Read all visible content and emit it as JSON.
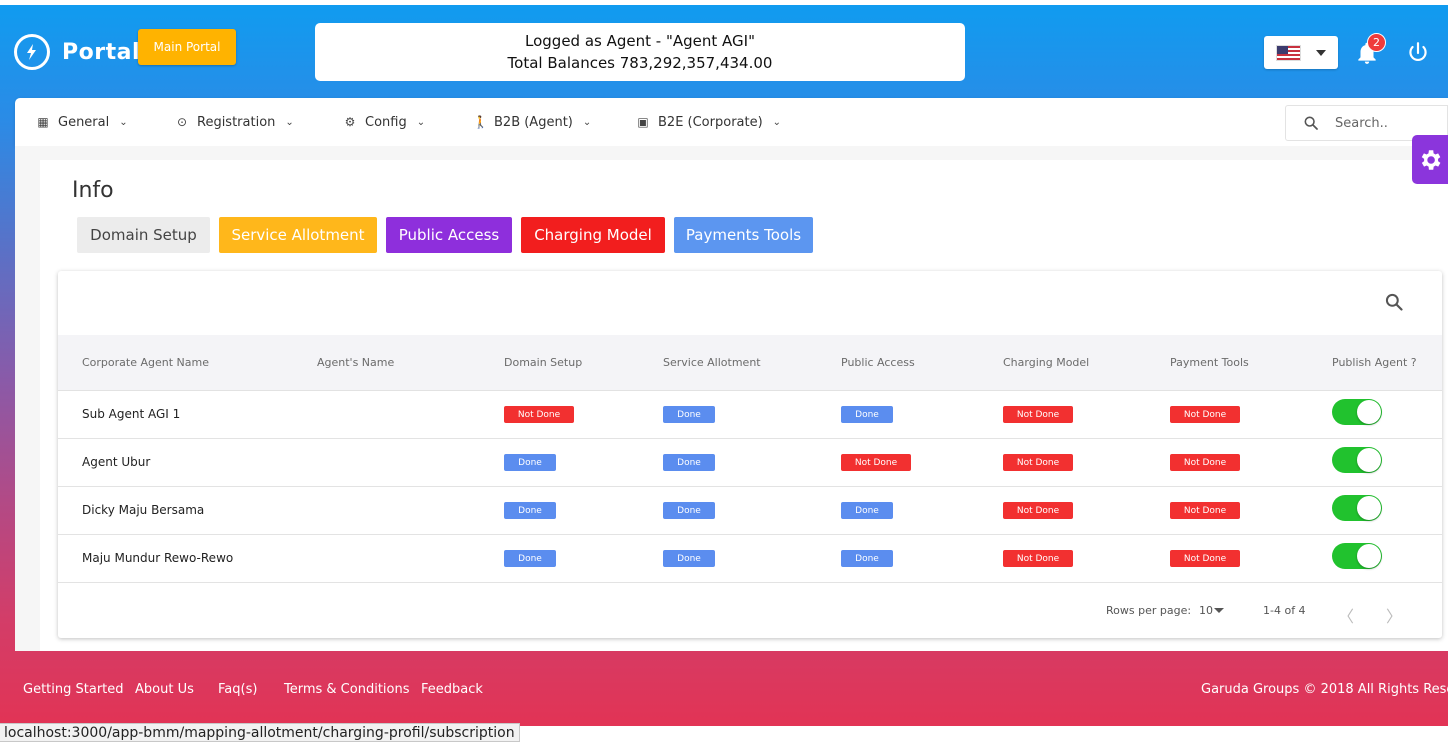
{
  "header": {
    "logo_text": "Portal",
    "main_portal_label": "Main Portal",
    "agent_line1": "Logged as Agent - \"Agent AGI\"",
    "agent_line2": "Total Balances 783,292,357,434.00",
    "notification_count": "2",
    "language_flag": "us-flag-icon"
  },
  "nav": {
    "items": [
      {
        "label": "General",
        "icon": "grid-icon"
      },
      {
        "label": "Registration",
        "icon": "target-icon"
      },
      {
        "label": "Config",
        "icon": "gear-icon"
      },
      {
        "label": "B2B (Agent)",
        "icon": "walking-icon"
      },
      {
        "label": "B2E (Corporate)",
        "icon": "id-card-icon"
      }
    ],
    "search_placeholder": "Search.."
  },
  "page": {
    "title": "Info",
    "tabs": [
      {
        "label": "Domain Setup",
        "color": "#ececec",
        "text_color": "#444444"
      },
      {
        "label": "Service Allotment",
        "color": "#ffb71b",
        "text_color": "#ffffff"
      },
      {
        "label": "Public Access",
        "color": "#8e2fdc",
        "text_color": "#ffffff"
      },
      {
        "label": "Charging Model",
        "color": "#f21e1e",
        "text_color": "#ffffff"
      },
      {
        "label": "Payments Tools",
        "color": "#5c96f0",
        "text_color": "#ffffff"
      }
    ]
  },
  "table": {
    "columns": [
      "Corporate Agent Name",
      "Agent's Name",
      "Domain Setup",
      "Service Allotment",
      "Public Access",
      "Charging Model",
      "Payment Tools",
      "Publish Agent ?"
    ],
    "rows": [
      {
        "corporate": "Sub Agent AGI 1",
        "agent": "",
        "domain": "Not Done",
        "service": "Done",
        "public": "Done",
        "charging": "Not Done",
        "payment": "Not Done",
        "publish": true
      },
      {
        "corporate": "Agent Ubur",
        "agent": "",
        "domain": "Done",
        "service": "Done",
        "public": "Not Done",
        "charging": "Not Done",
        "payment": "Not Done",
        "publish": true
      },
      {
        "corporate": "Dicky Maju Bersama",
        "agent": "",
        "domain": "Done",
        "service": "Done",
        "public": "Done",
        "charging": "Not Done",
        "payment": "Not Done",
        "publish": true
      },
      {
        "corporate": "Maju Mundur Rewo-Rewo",
        "agent": "",
        "domain": "Done",
        "service": "Done",
        "public": "Done",
        "charging": "Not Done",
        "payment": "Not Done",
        "publish": true
      }
    ],
    "rows_per_page_label": "Rows per page:",
    "rows_per_page_value": "10",
    "range_label": "1-4 of 4"
  },
  "footer": {
    "links": [
      "Getting Started",
      "About Us",
      "Faq(s)",
      "Terms & Conditions",
      "Feedback"
    ],
    "copyright": "Garuda Groups © 2018 All Rights Rese"
  },
  "statusbar": {
    "url": "localhost:3000/app-bmm/mapping-allotment/charging-profil/subscription"
  },
  "colors": {
    "done": "#5b8def",
    "not_done": "#f23030",
    "toggle_on": "#21c22e",
    "accent_purple": "#8b35dc",
    "main_portal": "#ffb300"
  }
}
